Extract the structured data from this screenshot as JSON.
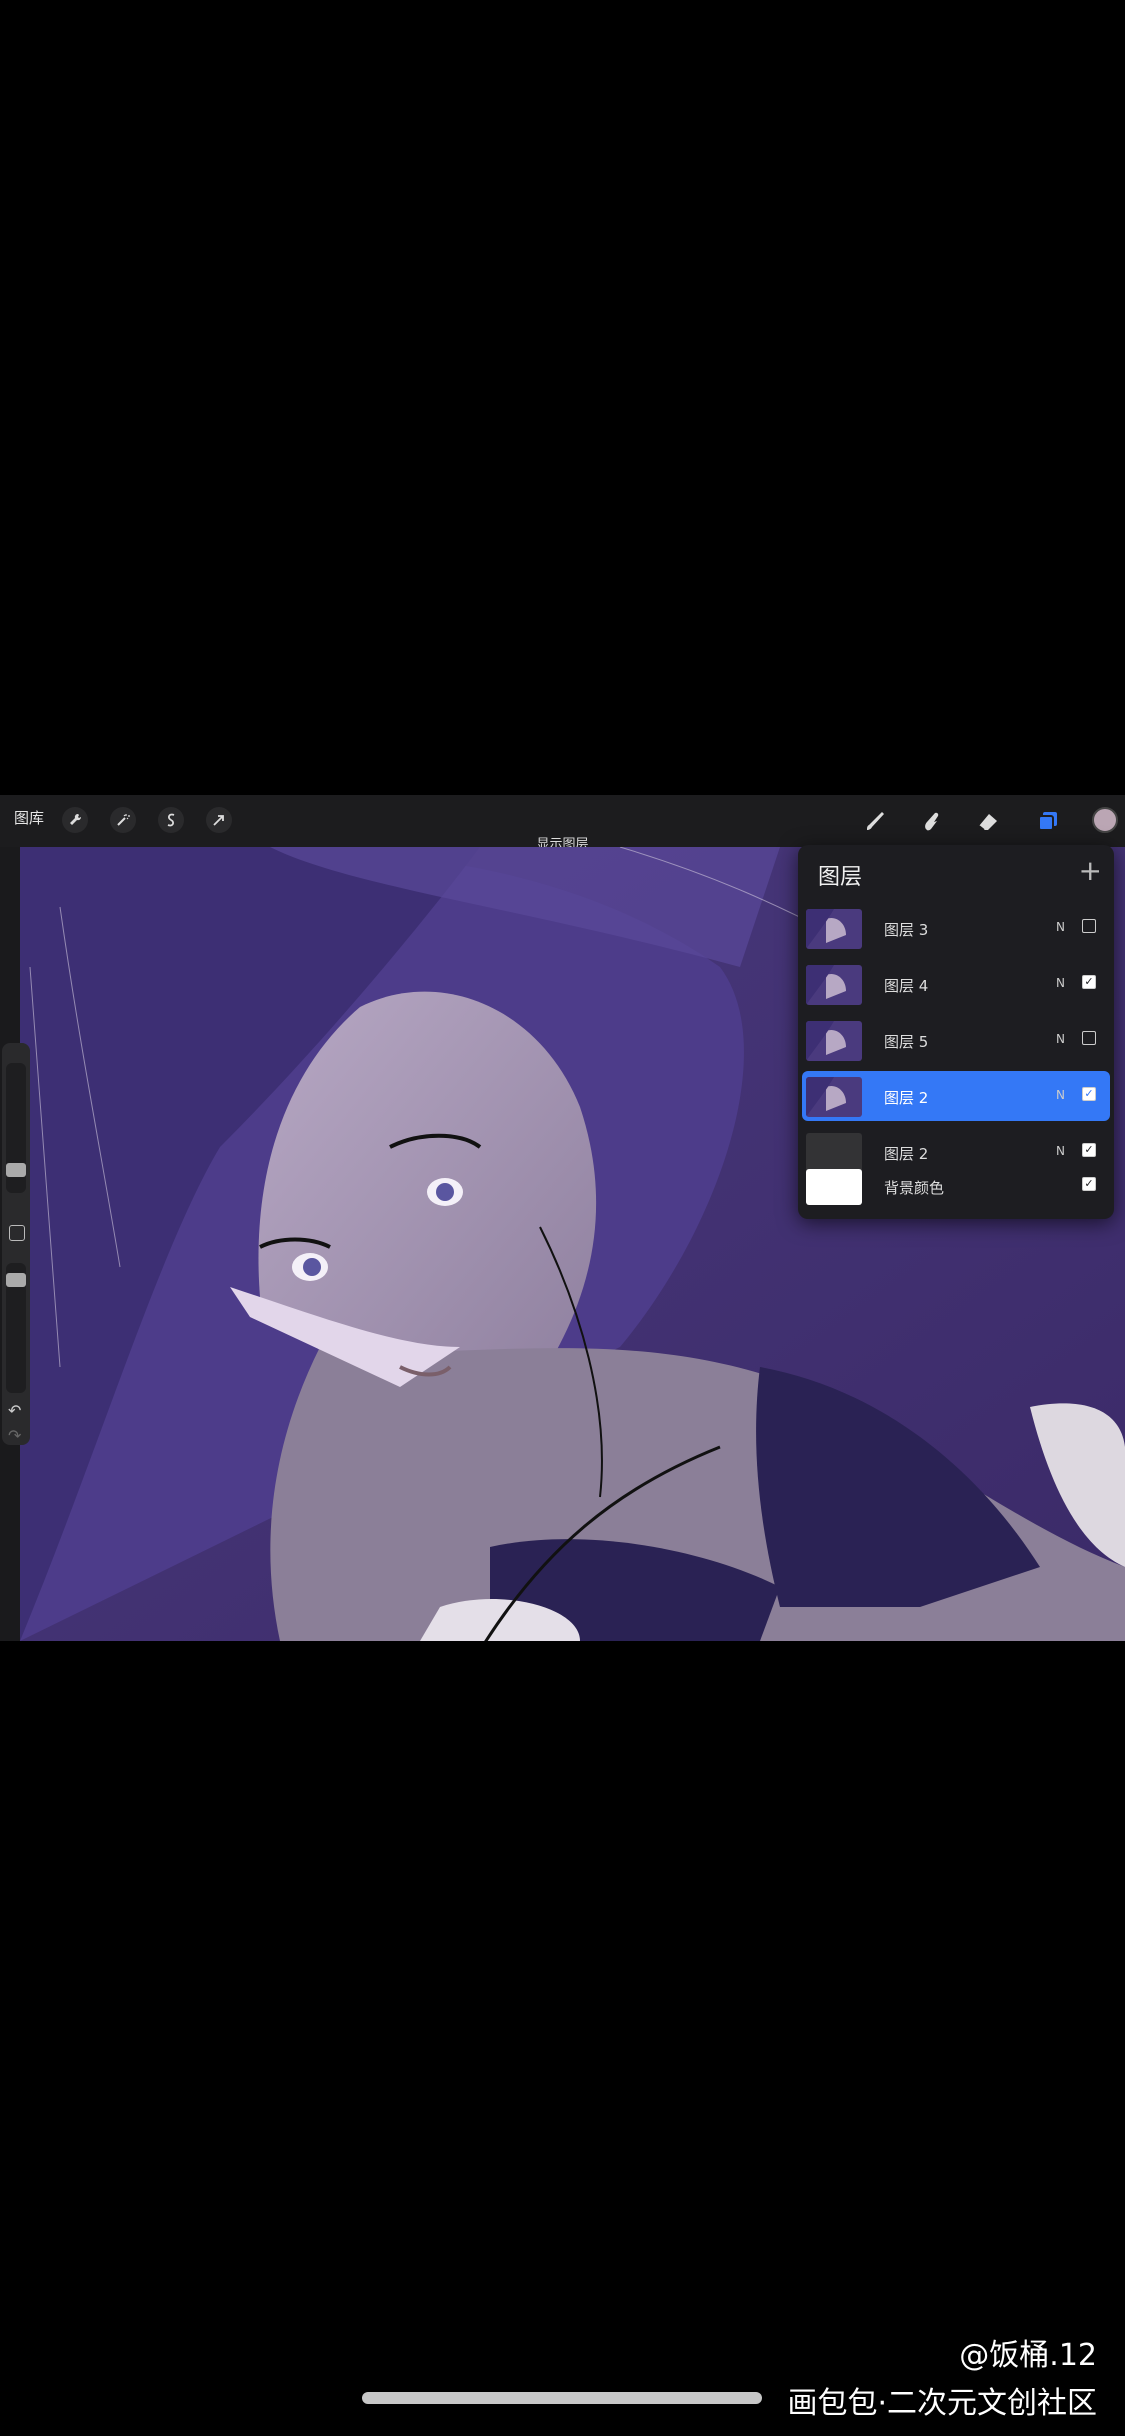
{
  "toolbar": {
    "gallery_label": "图库",
    "left_tools": [
      "wrench-icon",
      "magic-wand-icon",
      "selection-icon",
      "transform-arrow-icon"
    ],
    "right_tools": [
      "brush-icon",
      "smudge-icon",
      "eraser-icon",
      "layers-icon"
    ],
    "color": "#bba6b4"
  },
  "hint": "显示图层",
  "layers_panel": {
    "title": "图层",
    "add_label": "+",
    "rows": [
      {
        "name": "图层 3",
        "mode": "N",
        "visible": false,
        "active": false
      },
      {
        "name": "图层 4",
        "mode": "N",
        "visible": true,
        "active": false
      },
      {
        "name": "图层 5",
        "mode": "N",
        "visible": false,
        "active": false
      },
      {
        "name": "图层 2",
        "mode": "N",
        "visible": true,
        "active": true
      },
      {
        "name": "图层 2",
        "mode": "N",
        "visible": true,
        "active": false
      },
      {
        "name": "背景颜色",
        "mode": "",
        "visible": true,
        "active": false
      }
    ]
  },
  "watermark": {
    "author": "@饭桶.12",
    "site": "画包包·二次元文创社区"
  },
  "colors": {
    "accent": "#3478f6",
    "panel": "#1d1d21",
    "toolbar": "#1c1c1e"
  }
}
